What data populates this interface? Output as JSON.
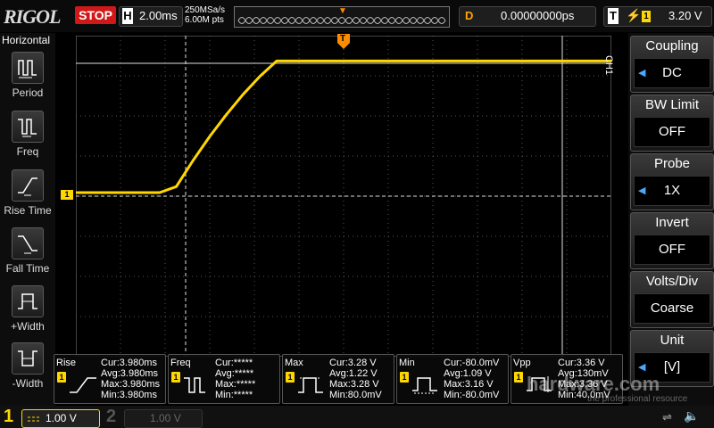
{
  "header": {
    "logo": "RIGOL",
    "run_status": "STOP",
    "horizontal_label": "H",
    "timebase": "2.00ms",
    "sample_rate": "250MSa/s",
    "mem_depth": "6.00M pts",
    "delay_label": "D",
    "delay_value": "0.00000000ps",
    "trigger_label": "T",
    "trigger_source": "1",
    "trigger_level": "3.20 V"
  },
  "left_menu": {
    "title": "Horizontal",
    "items": [
      {
        "label": "Period",
        "icon": "period-icon"
      },
      {
        "label": "Freq",
        "icon": "frequency-icon"
      },
      {
        "label": "Rise Time",
        "icon": "rise-time-icon"
      },
      {
        "label": "Fall Time",
        "icon": "fall-time-icon"
      },
      {
        "label": "+Width",
        "icon": "positive-width-icon"
      },
      {
        "label": "-Width",
        "icon": "negative-width-icon"
      }
    ]
  },
  "right_menu": {
    "channel_tag": "CH1",
    "items": [
      {
        "title": "Coupling",
        "value": "DC"
      },
      {
        "title": "BW Limit",
        "value": "OFF"
      },
      {
        "title": "Probe",
        "value": "1X"
      },
      {
        "title": "Invert",
        "value": "OFF"
      },
      {
        "title": "Volts/Div",
        "value": "Coarse"
      },
      {
        "title": "Unit",
        "value": "[V]"
      }
    ]
  },
  "waveform": {
    "channel_marker": "1",
    "trigger_marker": "T",
    "trace_color": "#ffd700",
    "samples_v": [
      0.0,
      0.0,
      0.0,
      0.0,
      0.0,
      0.0,
      0.15,
      0.8,
      1.4,
      1.95,
      2.45,
      2.9,
      3.28,
      3.28,
      3.28,
      3.28,
      3.28,
      3.28,
      3.28,
      3.28,
      3.28,
      3.28,
      3.28,
      3.28,
      3.28,
      3.28,
      3.28,
      3.28,
      3.28,
      3.28,
      3.28,
      3.28,
      3.28
    ]
  },
  "measurements": [
    {
      "name": "Rise",
      "channel": "1",
      "cur": "Cur:3.980ms",
      "avg": "Avg:3.980ms",
      "max": "Max:3.980ms",
      "min": "Min:3.980ms",
      "icon": "rise-time-icon"
    },
    {
      "name": "Freq",
      "channel": "1",
      "cur": "Cur:*****",
      "avg": "Avg:*****",
      "max": "Max:*****",
      "min": "Min:*****",
      "icon": "frequency-icon"
    },
    {
      "name": "Max",
      "channel": "1",
      "cur": "Cur:3.28 V",
      "avg": "Avg:1.22 V",
      "max": "Max:3.28 V",
      "min": "Min:80.0mV",
      "icon": "max-icon"
    },
    {
      "name": "Min",
      "channel": "1",
      "cur": "Cur:-80.0mV",
      "avg": "Avg:1.09 V",
      "max": "Max:3.16 V",
      "min": "Min:-80.0mV",
      "icon": "min-icon"
    },
    {
      "name": "Vpp",
      "channel": "1",
      "cur": "Cur:3.36 V",
      "avg": "Avg:130mV",
      "max": "Max:3.36 V",
      "min": "Min:40.0mV",
      "icon": "vpp-icon"
    }
  ],
  "footer": {
    "ch1_number": "1",
    "ch1_scale": "1.00 V",
    "ch2_number": "2",
    "ch2_scale": "1.00 V",
    "watermark": "hardware.com",
    "watermark_sub": "the professional resource"
  }
}
